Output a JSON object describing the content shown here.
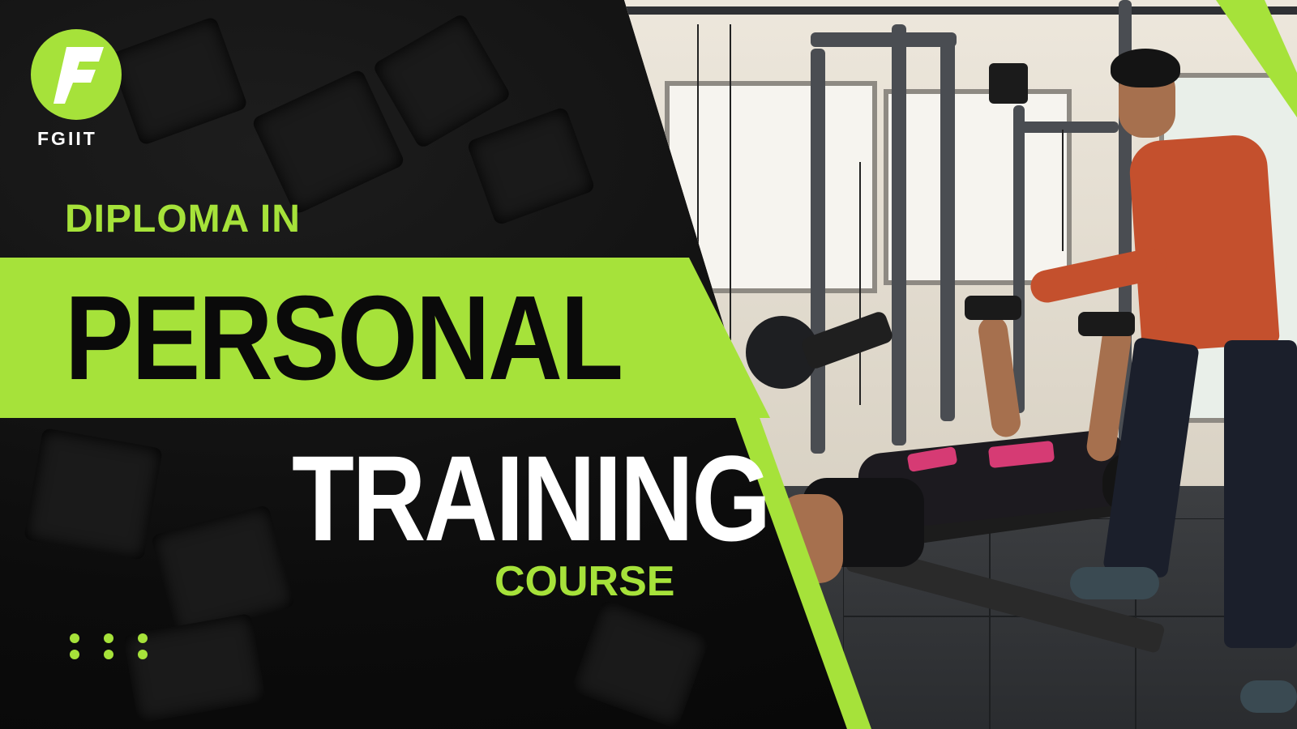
{
  "brand": {
    "logo_icon": "flame-f-logo-icon",
    "name": "FGIIT"
  },
  "headline": {
    "line1": "DIPLOMA IN",
    "line2": "PERSONAL",
    "line3": "TRAINING",
    "line4": "COURSE"
  },
  "decor": {
    "dots_icon": "dot-grid-icon"
  },
  "colors": {
    "accent": "#a6e23a",
    "background": "#0a0a0a",
    "text_light": "#ffffff",
    "text_dark": "#0a0a0a"
  }
}
